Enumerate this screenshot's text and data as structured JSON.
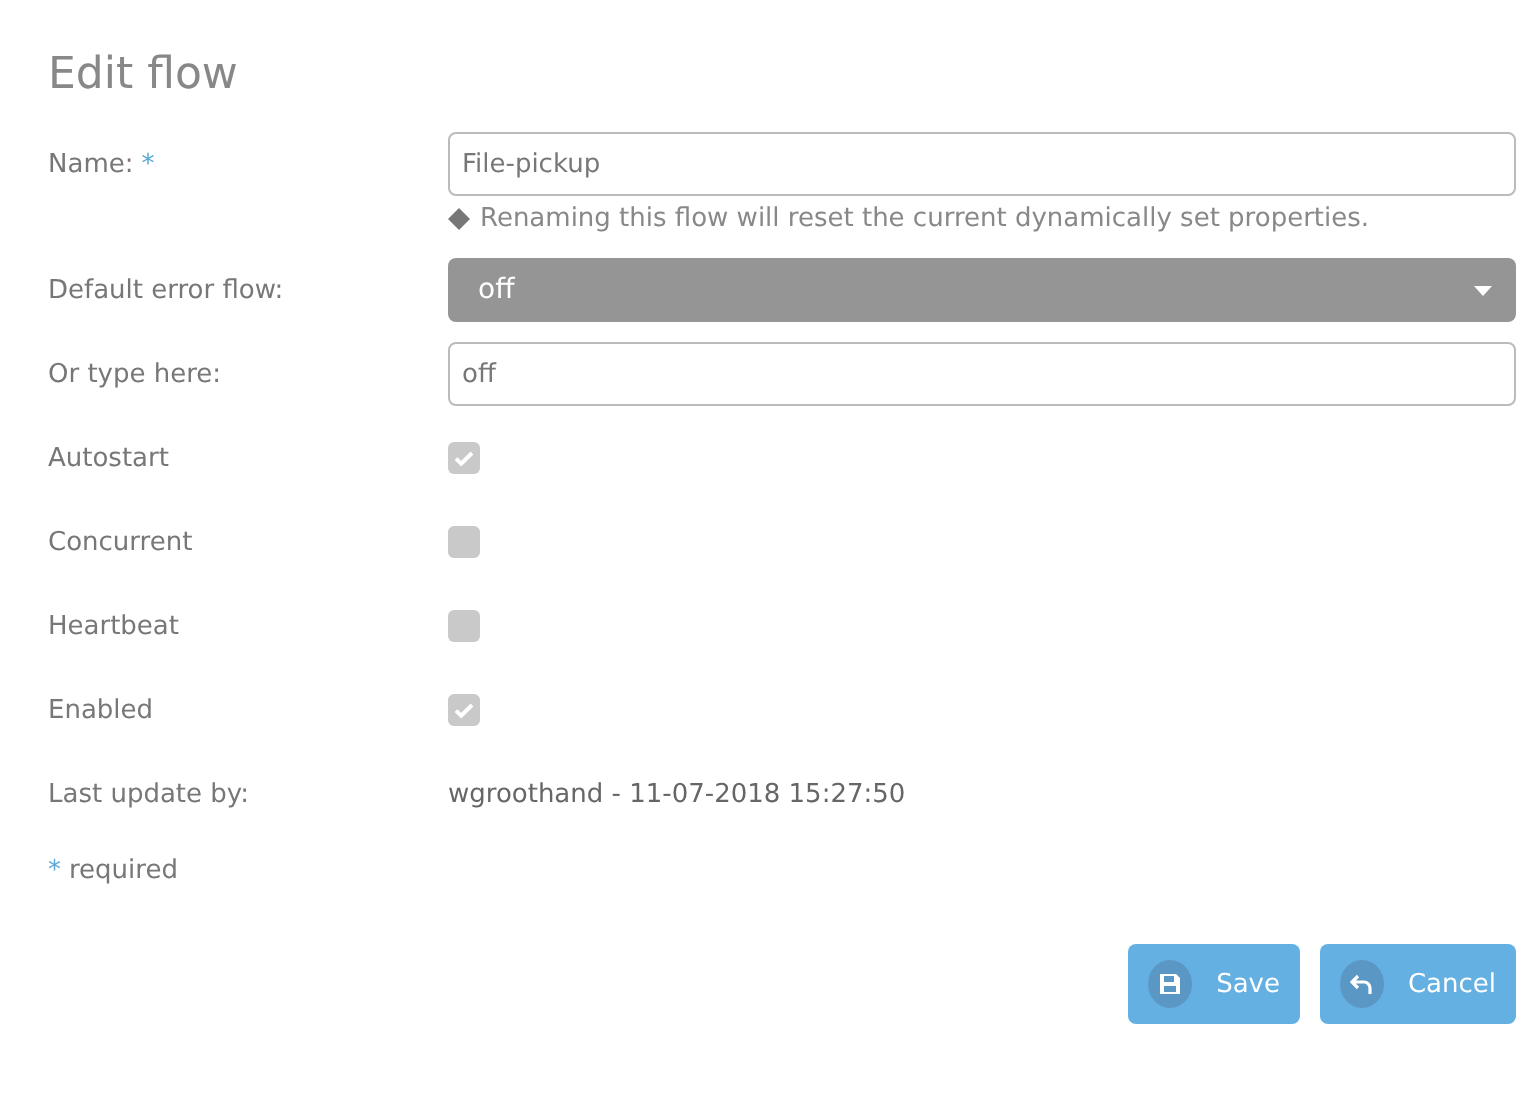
{
  "title": "Edit flow",
  "rows": [
    {
      "kind": "text",
      "label": "Name:",
      "required_mark": "*",
      "value": "File-pickup",
      "note": "Renaming this flow will reset the current dynamically set properties."
    },
    {
      "kind": "select",
      "label": "Default error flow:",
      "value": "off"
    },
    {
      "kind": "text",
      "label": "Or type here:",
      "value": "off"
    },
    {
      "kind": "checkbox",
      "label": "Autostart",
      "checked": true
    },
    {
      "kind": "checkbox",
      "label": "Concurrent",
      "checked": false
    },
    {
      "kind": "checkbox",
      "label": "Heartbeat",
      "checked": false
    },
    {
      "kind": "checkbox",
      "label": "Enabled",
      "checked": true
    },
    {
      "kind": "readonly",
      "label": "Last update by:",
      "value": "wgroothand - 11-07-2018 15:27:50"
    }
  ],
  "footnote": {
    "mark": "*",
    "text": "required"
  },
  "buttons": [
    {
      "kind": "save",
      "label": "Save"
    },
    {
      "kind": "cancel",
      "label": "Cancel"
    }
  ]
}
